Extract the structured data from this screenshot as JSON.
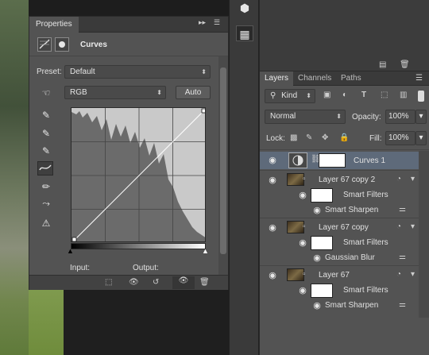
{
  "properties": {
    "tab_label": "Properties",
    "adjustment_title": "Curves",
    "preset_label": "Preset:",
    "preset_value": "Default",
    "channel_value": "RGB",
    "auto_label": "Auto",
    "input_label": "Input:",
    "output_label": "Output:"
  },
  "layers": {
    "tabs": [
      "Layers",
      "Channels",
      "Paths"
    ],
    "kind_label": "Kind",
    "blend_mode": "Normal",
    "opacity_label": "Opacity:",
    "opacity_value": "100%",
    "lock_label": "Lock:",
    "fill_label": "Fill:",
    "fill_value": "100%",
    "rows": [
      {
        "name": "Curves 1",
        "selected": true
      },
      {
        "name": "Layer 67 copy 2"
      },
      {
        "name": "Smart Filters"
      },
      {
        "name": "Smart Sharpen"
      },
      {
        "name": "Layer 67 copy"
      },
      {
        "name": "Smart Filters"
      },
      {
        "name": "Gaussian Blur"
      },
      {
        "name": "Layer 67"
      },
      {
        "name": "Smart Filters"
      },
      {
        "name": "Smart Sharpen"
      }
    ]
  },
  "colors": {
    "panel": "#535353",
    "selected_row": "#5e6a7a",
    "dark": "#282828"
  }
}
